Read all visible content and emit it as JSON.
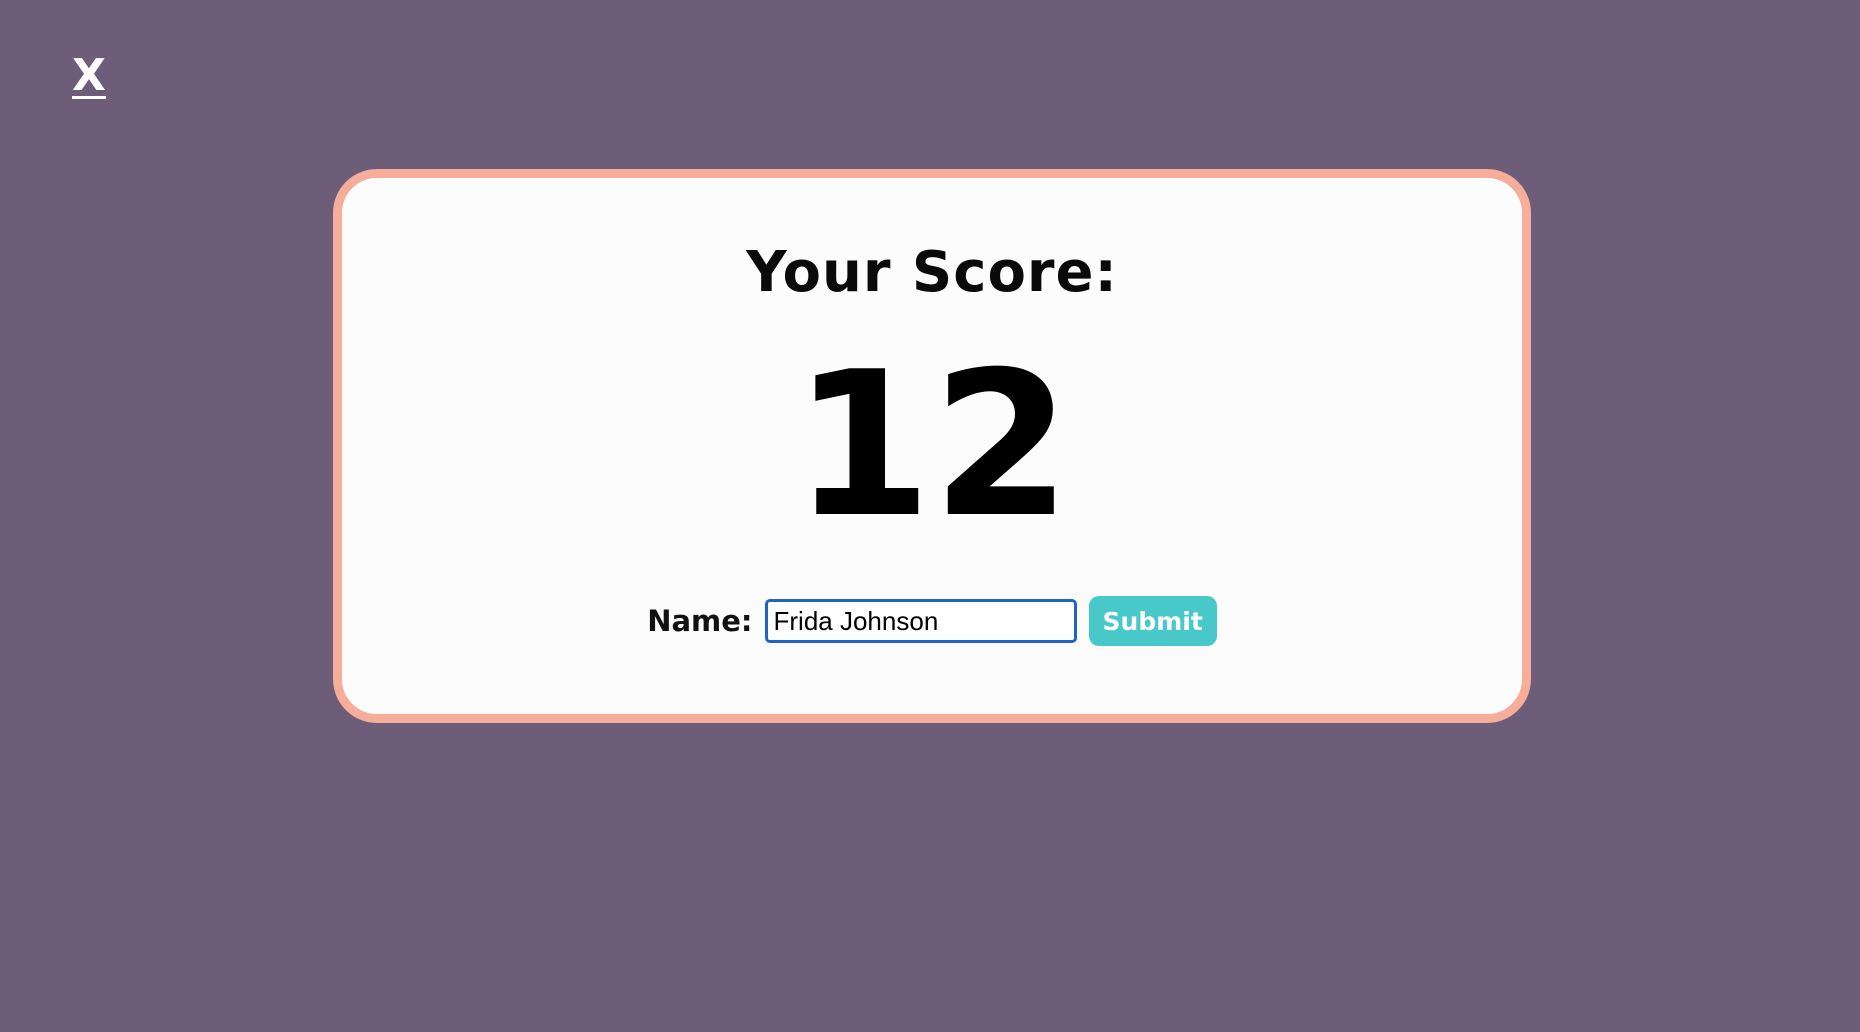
{
  "header": {
    "close_label": "X"
  },
  "score_card": {
    "heading": "Your Score:",
    "score": "12",
    "name_label": "Name:",
    "name_value": "Frida Johnson",
    "submit_label": "Submit"
  },
  "colors": {
    "background": "#6e5d79",
    "card_border": "#f6ae9b",
    "card_background": "#fcfcfc",
    "submit_button": "#49c8c9",
    "input_border_focus": "#1e63c5"
  }
}
